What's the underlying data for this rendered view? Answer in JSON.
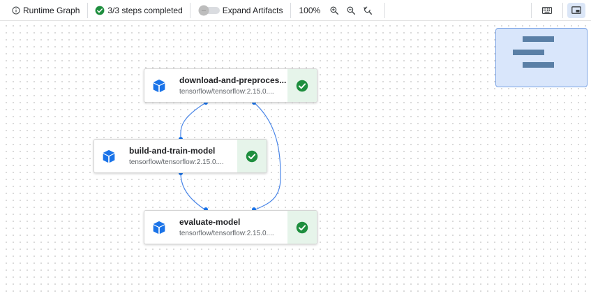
{
  "toolbar": {
    "graph_label": "Runtime Graph",
    "steps_label": "3/3 steps completed",
    "expand_label": "Expand Artifacts",
    "zoom_level": "100%"
  },
  "nodes": [
    {
      "title": "download-and-preproces...",
      "subtitle": "tensorflow/tensorflow:2.15.0....",
      "status": "succeeded"
    },
    {
      "title": "build-and-train-model",
      "subtitle": "tensorflow/tensorflow:2.15.0....",
      "status": "succeeded"
    },
    {
      "title": "evaluate-model",
      "subtitle": "tensorflow/tensorflow:2.15.0....",
      "status": "succeeded"
    }
  ],
  "colors": {
    "accent": "#1a73e8",
    "success": "#1e8e3e",
    "success_bg": "#e6f4ea",
    "edge": "#4a86e8",
    "minimap_bg": "#d9e6fb",
    "minimap_node": "#5a7fa6"
  },
  "icons": [
    "info-icon",
    "check-circle-icon",
    "toggle-switch",
    "zoom-in-icon",
    "zoom-out-icon",
    "zoom-reset-icon",
    "keyboard-icon",
    "minimap-toggle-icon",
    "cube-icon"
  ]
}
